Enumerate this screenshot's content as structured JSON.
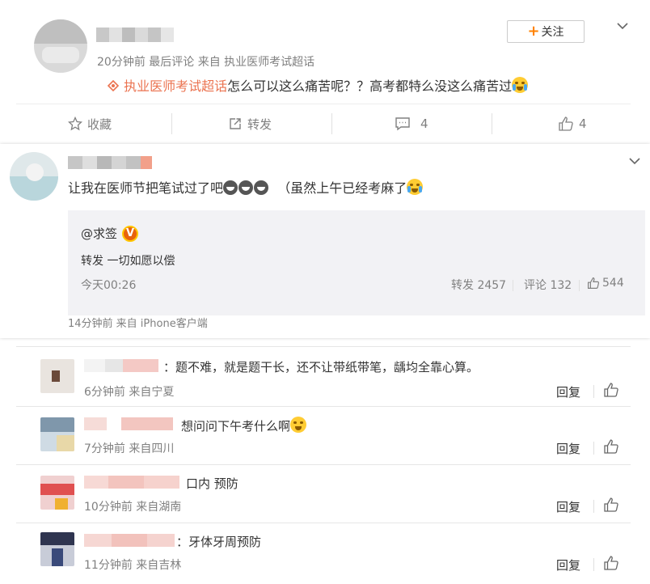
{
  "post": {
    "time_line": "20分钟前 最后评论 来自 执业医师考试超话",
    "follow_label": "关注",
    "follow_plus": "+",
    "topic": "执业医师考试超话",
    "text": "怎么可以这么痛苦呢？？高考都特么没这么痛苦过",
    "actions": {
      "favorite": "收藏",
      "repost": "转发",
      "comment_count": "4",
      "like_count": "4"
    }
  },
  "repost_card": {
    "text": "让我在医师节把笔试过了吧",
    "text_tail": "（虽然上午已经考麻了",
    "original": {
      "author": "@求签",
      "vip_mark": "V",
      "content": "转发 一切如愿以偿",
      "time": "今天00:26",
      "repost_stat": "转发 2457",
      "comment_stat": "评论 132",
      "like_stat": "544"
    },
    "source": "14分钟前 来自 iPhone客户端"
  },
  "comments": [
    {
      "text": "：题不难，就是题干长，还不让带纸带笔，龋均全靠心算。",
      "meta": "6分钟前 来自宁夏",
      "reply": "回复"
    },
    {
      "text": "想问问下午考什么啊",
      "meta": "7分钟前 来自四川",
      "reply": "回复"
    },
    {
      "text": "口内 预防",
      "meta": "10分钟前 来自湖南",
      "reply": "回复"
    },
    {
      "text": "：牙体牙周预防",
      "meta": "11分钟前 来自吉林",
      "reply": "回复"
    }
  ],
  "colors": {
    "accent": "#ff8200",
    "topic": "#eb7350",
    "meta": "#808080"
  }
}
